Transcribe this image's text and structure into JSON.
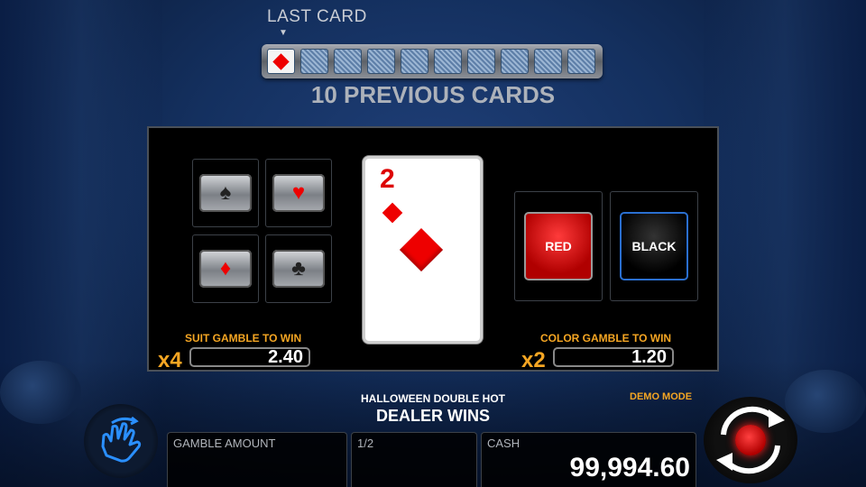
{
  "header": {
    "last_card_label": "LAST CARD",
    "previous_cards_label": "10 PREVIOUS CARDS",
    "last_card": {
      "rank": "2",
      "suit": "diamonds"
    },
    "history_face_down_count": 9
  },
  "main_card": {
    "rank": "2",
    "suit": "diamonds"
  },
  "suit_buttons": [
    {
      "name": "spade",
      "glyph": "♠",
      "color": "black"
    },
    {
      "name": "heart",
      "glyph": "♥",
      "color": "red"
    },
    {
      "name": "diamond",
      "glyph": "♦",
      "color": "red"
    },
    {
      "name": "club",
      "glyph": "♣",
      "color": "black"
    }
  ],
  "suit_gamble": {
    "title": "SUIT GAMBLE TO WIN",
    "multiplier": "x4",
    "value": "2.40"
  },
  "color_gamble": {
    "title": "COLOR GAMBLE TO WIN",
    "multiplier": "x2",
    "value": "1.20"
  },
  "color_buttons": {
    "red": "RED",
    "black": "BLACK"
  },
  "footer": {
    "game_name": "HALLOWEEN DOUBLE HOT",
    "message": "DEALER WINS",
    "mode": "DEMO MODE",
    "gamble_amount_label": "GAMBLE AMOUNT",
    "step_label": "1/2",
    "cash_label": "CASH",
    "cash_value": "99,994.60"
  },
  "colors": {
    "accent": "#f5a623",
    "red": "#e00000",
    "black_button_border": "#2a6fd0"
  },
  "icons": {
    "collect": "hand-swipe-icon",
    "spin": "spin-arrows-icon"
  }
}
